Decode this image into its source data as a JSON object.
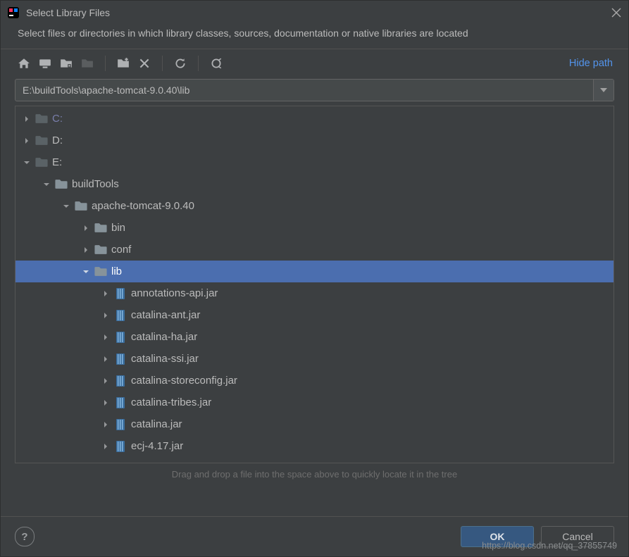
{
  "window": {
    "title": "Select Library Files",
    "subtitle": "Select files or directories in which library classes, sources, documentation or native libraries are located"
  },
  "toolbar": {
    "hide_path": "Hide path"
  },
  "path": {
    "value": "E:\\buildTools\\apache-tomcat-9.0.40\\lib"
  },
  "tree": [
    {
      "depth": 0,
      "expand": "closed",
      "icon": "folder-dim",
      "label": "C:",
      "style": "drive"
    },
    {
      "depth": 0,
      "expand": "closed",
      "icon": "folder-dim",
      "label": "D:",
      "style": "normal"
    },
    {
      "depth": 0,
      "expand": "open",
      "icon": "folder-dim",
      "label": "E:",
      "style": "normal"
    },
    {
      "depth": 1,
      "expand": "open",
      "icon": "folder",
      "label": "buildTools",
      "style": "normal"
    },
    {
      "depth": 2,
      "expand": "open",
      "icon": "folder",
      "label": "apache-tomcat-9.0.40",
      "style": "normal"
    },
    {
      "depth": 3,
      "expand": "closed",
      "icon": "folder",
      "label": "bin",
      "style": "normal"
    },
    {
      "depth": 3,
      "expand": "closed",
      "icon": "folder",
      "label": "conf",
      "style": "normal"
    },
    {
      "depth": 3,
      "expand": "open",
      "icon": "folder",
      "label": "lib",
      "style": "normal",
      "selected": true
    },
    {
      "depth": 4,
      "expand": "closed",
      "icon": "jar",
      "label": "annotations-api.jar",
      "style": "normal"
    },
    {
      "depth": 4,
      "expand": "closed",
      "icon": "jar",
      "label": "catalina-ant.jar",
      "style": "normal"
    },
    {
      "depth": 4,
      "expand": "closed",
      "icon": "jar",
      "label": "catalina-ha.jar",
      "style": "normal"
    },
    {
      "depth": 4,
      "expand": "closed",
      "icon": "jar",
      "label": "catalina-ssi.jar",
      "style": "normal"
    },
    {
      "depth": 4,
      "expand": "closed",
      "icon": "jar",
      "label": "catalina-storeconfig.jar",
      "style": "normal"
    },
    {
      "depth": 4,
      "expand": "closed",
      "icon": "jar",
      "label": "catalina-tribes.jar",
      "style": "normal"
    },
    {
      "depth": 4,
      "expand": "closed",
      "icon": "jar",
      "label": "catalina.jar",
      "style": "normal"
    },
    {
      "depth": 4,
      "expand": "closed",
      "icon": "jar",
      "label": "ecj-4.17.jar",
      "style": "normal"
    }
  ],
  "hint": "Drag and drop a file into the space above to quickly locate it in the tree",
  "buttons": {
    "ok": "OK",
    "cancel": "Cancel",
    "help": "?"
  },
  "watermark": "https://blog.csdn.net/qq_37855749"
}
